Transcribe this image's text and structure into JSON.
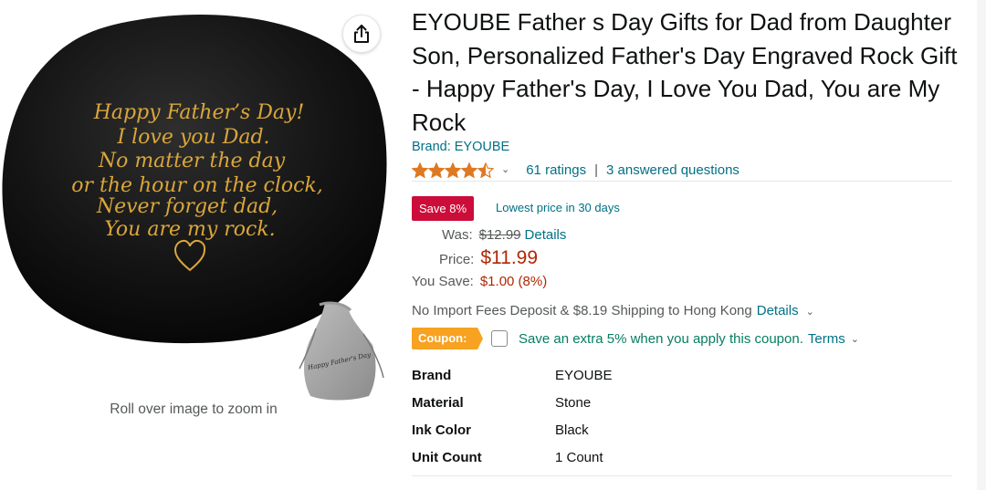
{
  "product": {
    "title": "EYOUBE Father s Day Gifts for Dad from Daughter Son, Personalized Father's Day Engraved Rock Gift - Happy Father's Day, I Love You Dad, You are My Rock",
    "brand_link": "Brand: EYOUBE",
    "rating_stars": 4.5,
    "ratings_count": "61 ratings",
    "rating_separator": "|",
    "answered_questions": "3 answered questions"
  },
  "image": {
    "engraving_lines": [
      "Happy Father’s Day!",
      "I love you Dad.",
      "No matter the day",
      "or the hour on the clock,",
      "Never forget dad,",
      "You are my rock."
    ],
    "pouch_text": "Happy Father's Day",
    "zoom_hint": "Roll over image to zoom in"
  },
  "deal": {
    "save_badge": "Save 8%",
    "deal_text": "Lowest price in 30 days"
  },
  "pricing": {
    "was_label": "Was:",
    "was_price": "$12.99",
    "was_details": "Details",
    "price_label": "Price:",
    "price_value": "$11.99",
    "you_save_label": "You Save:",
    "you_save_value": "$1.00 (8%)"
  },
  "shipping": {
    "text": "No Import Fees Deposit & $8.19 Shipping to Hong Kong",
    "details_link": "Details"
  },
  "coupon": {
    "badge": "Coupon:",
    "text": "Save an extra 5% when you apply this coupon.",
    "terms": "Terms"
  },
  "specs": [
    {
      "key": "Brand",
      "value": "EYOUBE"
    },
    {
      "key": "Material",
      "value": "Stone"
    },
    {
      "key": "Ink Color",
      "value": "Black"
    },
    {
      "key": "Unit Count",
      "value": "1 Count"
    }
  ],
  "colors": {
    "link": "#007185",
    "price_red": "#b12704",
    "save_badge": "#cc0c39",
    "coupon_badge": "#f7a221",
    "coupon_text": "#067d62",
    "star": "#de7921",
    "engraving_gold": "#d9a63a"
  },
  "icons": {
    "share": "share-icon",
    "star": "star-icon",
    "chevron": "chevron-down-icon",
    "heart": "heart-icon"
  }
}
